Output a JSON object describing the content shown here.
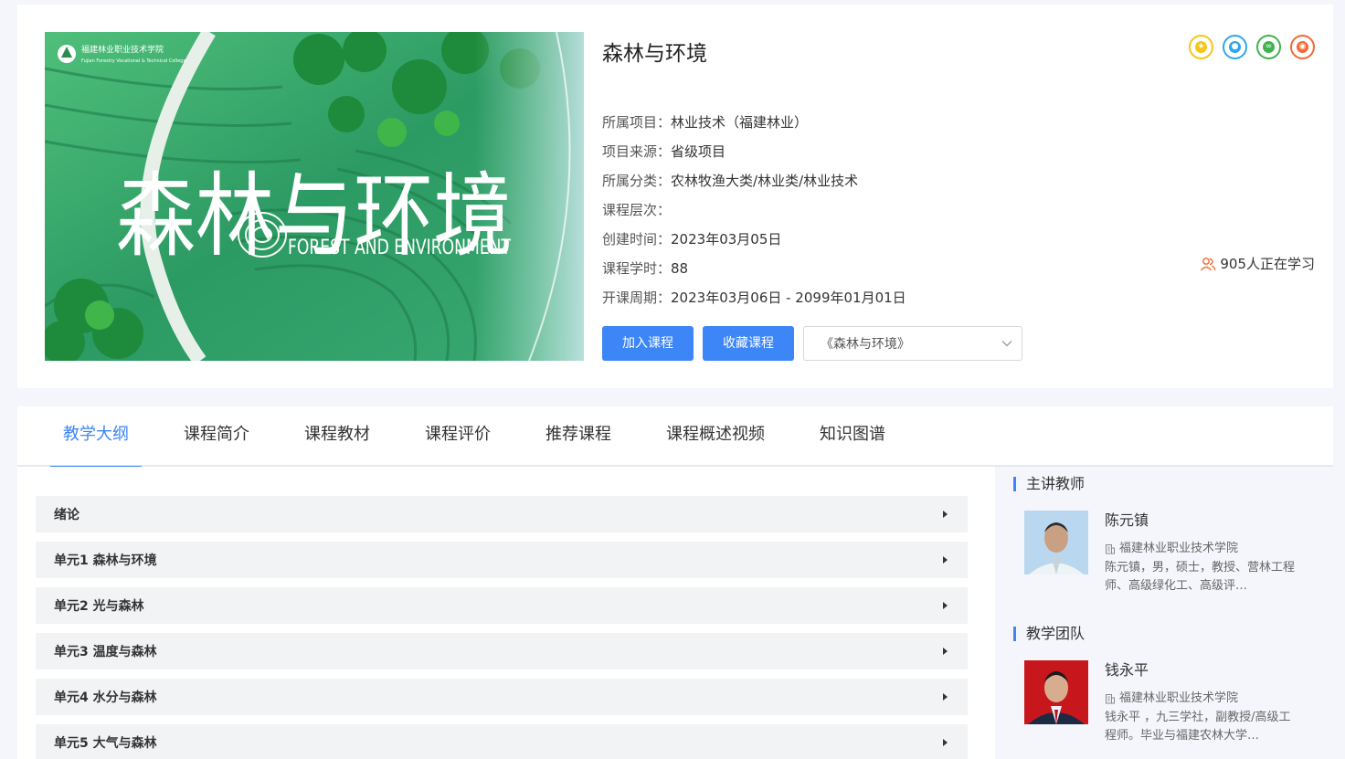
{
  "course": {
    "title": "森林与环境",
    "cover": {
      "school_name": "福建林业职业技术学院",
      "school_name_en": "Fujian Forestry Vocational & Technical College",
      "title_cn": "森林与环境",
      "title_en": "FOREST AND ENVIRONMENT"
    },
    "meta": [
      {
        "label": "所属项目：",
        "value": "林业技术（福建林业）"
      },
      {
        "label": "项目来源：",
        "value": "省级项目"
      },
      {
        "label": "所属分类：",
        "value": "农林牧渔大类/林业类/林业技术"
      },
      {
        "label": "课程层次：",
        "value": ""
      },
      {
        "label": "创建时间：",
        "value": "2023年03月05日"
      },
      {
        "label": "课程学时：",
        "value": "88"
      },
      {
        "label": "开课周期：",
        "value": "2023年03月06日 - 2099年01月01日"
      }
    ],
    "learners_text": "905人正在学习",
    "join_label": "加入课程",
    "favorite_label": "收藏课程",
    "version_select": "《森林与环境》",
    "share": [
      {
        "icon": "qzone-icon",
        "color": "#f5c518"
      },
      {
        "icon": "qq-icon",
        "color": "#2fa6e8"
      },
      {
        "icon": "wechat-icon",
        "color": "#3fb34f"
      },
      {
        "icon": "weibo-icon",
        "color": "#f06a35"
      }
    ]
  },
  "tabs": [
    {
      "label": "教学大纲",
      "active": true
    },
    {
      "label": "课程简介",
      "active": false
    },
    {
      "label": "课程教材",
      "active": false
    },
    {
      "label": "课程评价",
      "active": false
    },
    {
      "label": "推荐课程",
      "active": false
    },
    {
      "label": "课程概述视频",
      "active": false
    },
    {
      "label": "知识图谱",
      "active": false
    }
  ],
  "outline": [
    {
      "label": "绪论"
    },
    {
      "label": "单元1 森林与环境"
    },
    {
      "label": "单元2 光与森林"
    },
    {
      "label": "单元3 温度与森林"
    },
    {
      "label": "单元4 水分与森林"
    },
    {
      "label": "单元5 大气与森林"
    }
  ],
  "sidebar": {
    "lead_heading": "主讲教师",
    "team_heading": "教学团队",
    "lead": {
      "name": "陈元镇",
      "org": "福建林业职业技术学院",
      "desc": "陈元镇，男，硕士，教授、营林工程师、高级绿化工、高级评…"
    },
    "team": {
      "name": "钱永平",
      "org": "福建林业职业技术学院",
      "desc": "钱永平 ，九三学社，副教授/高级工程师。毕业与福建农林大学…"
    }
  }
}
